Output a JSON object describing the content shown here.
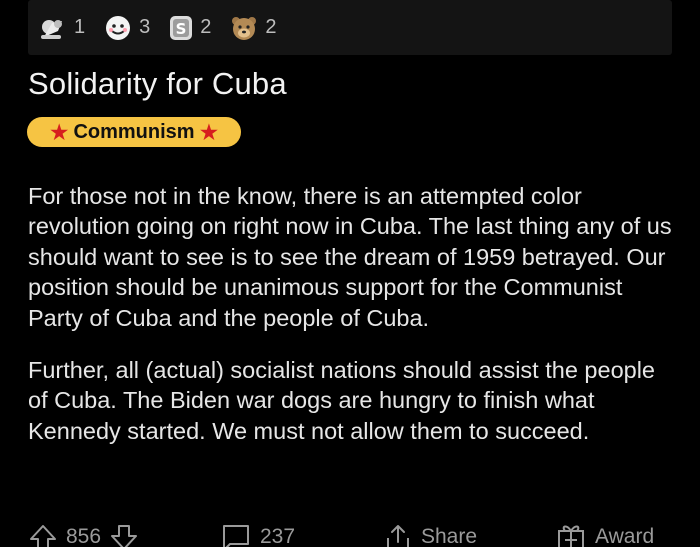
{
  "awards": [
    {
      "icon": "silver-award-icon",
      "count": "1"
    },
    {
      "icon": "wholesome-face-award-icon",
      "count": "3"
    },
    {
      "icon": "coin-award-icon",
      "count": "2"
    },
    {
      "icon": "bear-award-icon",
      "count": "2"
    }
  ],
  "post": {
    "title": "Solidarity for Cuba",
    "flair": {
      "left_star": "★",
      "label": "Communism",
      "right_star": "★",
      "color": "#f6c443",
      "star_color": "#d61e1e"
    },
    "paragraphs": [
      "For those not in the know, there is an attempted color revolution going on right now in Cuba. The last thing any of us should want to see is to see the dream of 1959 betrayed. Our position should be unanimous support for the Communist Party of Cuba and the people of Cuba.",
      "Further, all (actual) socialist nations should assist the people of Cuba. The Biden war dogs are hungry to finish what Kennedy started. We must not allow them to succeed."
    ]
  },
  "actions": {
    "upvote_icon": "upvote-arrow-icon",
    "score": "856",
    "downvote_icon": "downvote-arrow-icon",
    "comment_icon": "comment-icon",
    "comments": "237",
    "share_icon": "share-icon",
    "share_label": "Share",
    "award_icon": "gift-award-icon",
    "award_label": "Award"
  }
}
